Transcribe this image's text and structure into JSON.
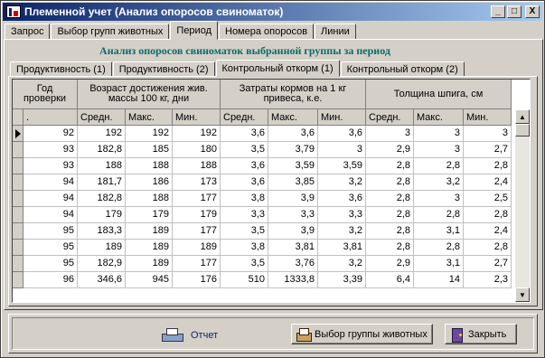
{
  "window": {
    "title": "Племенной учет (Анализ опоросов свиноматок)",
    "buttons": [
      "_",
      "□",
      "X"
    ]
  },
  "tabs": [
    {
      "label": "Запрос",
      "active": false
    },
    {
      "label": "Выбор групп животных",
      "active": false
    },
    {
      "label": "Период",
      "active": true
    },
    {
      "label": "Номера опоросов",
      "active": false
    },
    {
      "label": "Линии",
      "active": false
    }
  ],
  "subtitle": "Анализ опоросов свиноматок выбранной группы за период",
  "subtabs": [
    {
      "label": "Продуктивность (1)",
      "active": false
    },
    {
      "label": "Продуктивность (2)",
      "active": false
    },
    {
      "label": "Контрольный откорм (1)",
      "active": true
    },
    {
      "label": "Контрольный откорм (2)",
      "active": false
    }
  ],
  "grid": {
    "group_headers": [
      "Год проверки",
      "Возраст достижения жив. массы 100 кг, дни",
      "Затраты кормов на 1 кг привеса, к.е.",
      "Толщина шпига, см"
    ],
    "sub_headers": [
      ".",
      "Средн.",
      "Макс.",
      "Мин.",
      "Средн.",
      "Макс.",
      "Мин.",
      "Средн.",
      "Макс.",
      "Мин."
    ],
    "current_row": 0,
    "rows": [
      [
        "92",
        "192",
        "192",
        "192",
        "3,6",
        "3,6",
        "3,6",
        "3",
        "3",
        "3"
      ],
      [
        "93",
        "182,8",
        "185",
        "180",
        "3,5",
        "3,79",
        "3",
        "2,9",
        "3",
        "2,7"
      ],
      [
        "93",
        "188",
        "188",
        "188",
        "3,6",
        "3,59",
        "3,59",
        "2,8",
        "2,8",
        "2,8"
      ],
      [
        "94",
        "181,7",
        "186",
        "173",
        "3,6",
        "3,85",
        "3,2",
        "2,8",
        "3,2",
        "2,4"
      ],
      [
        "94",
        "182,8",
        "188",
        "177",
        "3,8",
        "3,9",
        "3,6",
        "2,8",
        "3",
        "2,5"
      ],
      [
        "94",
        "179",
        "179",
        "179",
        "3,3",
        "3,3",
        "3,3",
        "2,8",
        "2,8",
        "2,8"
      ],
      [
        "95",
        "183,3",
        "189",
        "177",
        "3,5",
        "3,9",
        "3,2",
        "2,8",
        "3,1",
        "2,4"
      ],
      [
        "95",
        "189",
        "189",
        "189",
        "3,8",
        "3,81",
        "3,81",
        "2,8",
        "2,8",
        "2,8"
      ],
      [
        "95",
        "182,9",
        "189",
        "177",
        "3,5",
        "3,76",
        "3,2",
        "2,9",
        "3,1",
        "2,7"
      ],
      [
        "96",
        "346,6",
        "945",
        "176",
        "510",
        "1333,8",
        "3,39",
        "6,4",
        "14",
        "2,3"
      ]
    ]
  },
  "footer": {
    "report_label": "Отчет",
    "select_group_label": "Выбор группы животных",
    "close_label": "Закрыть"
  }
}
